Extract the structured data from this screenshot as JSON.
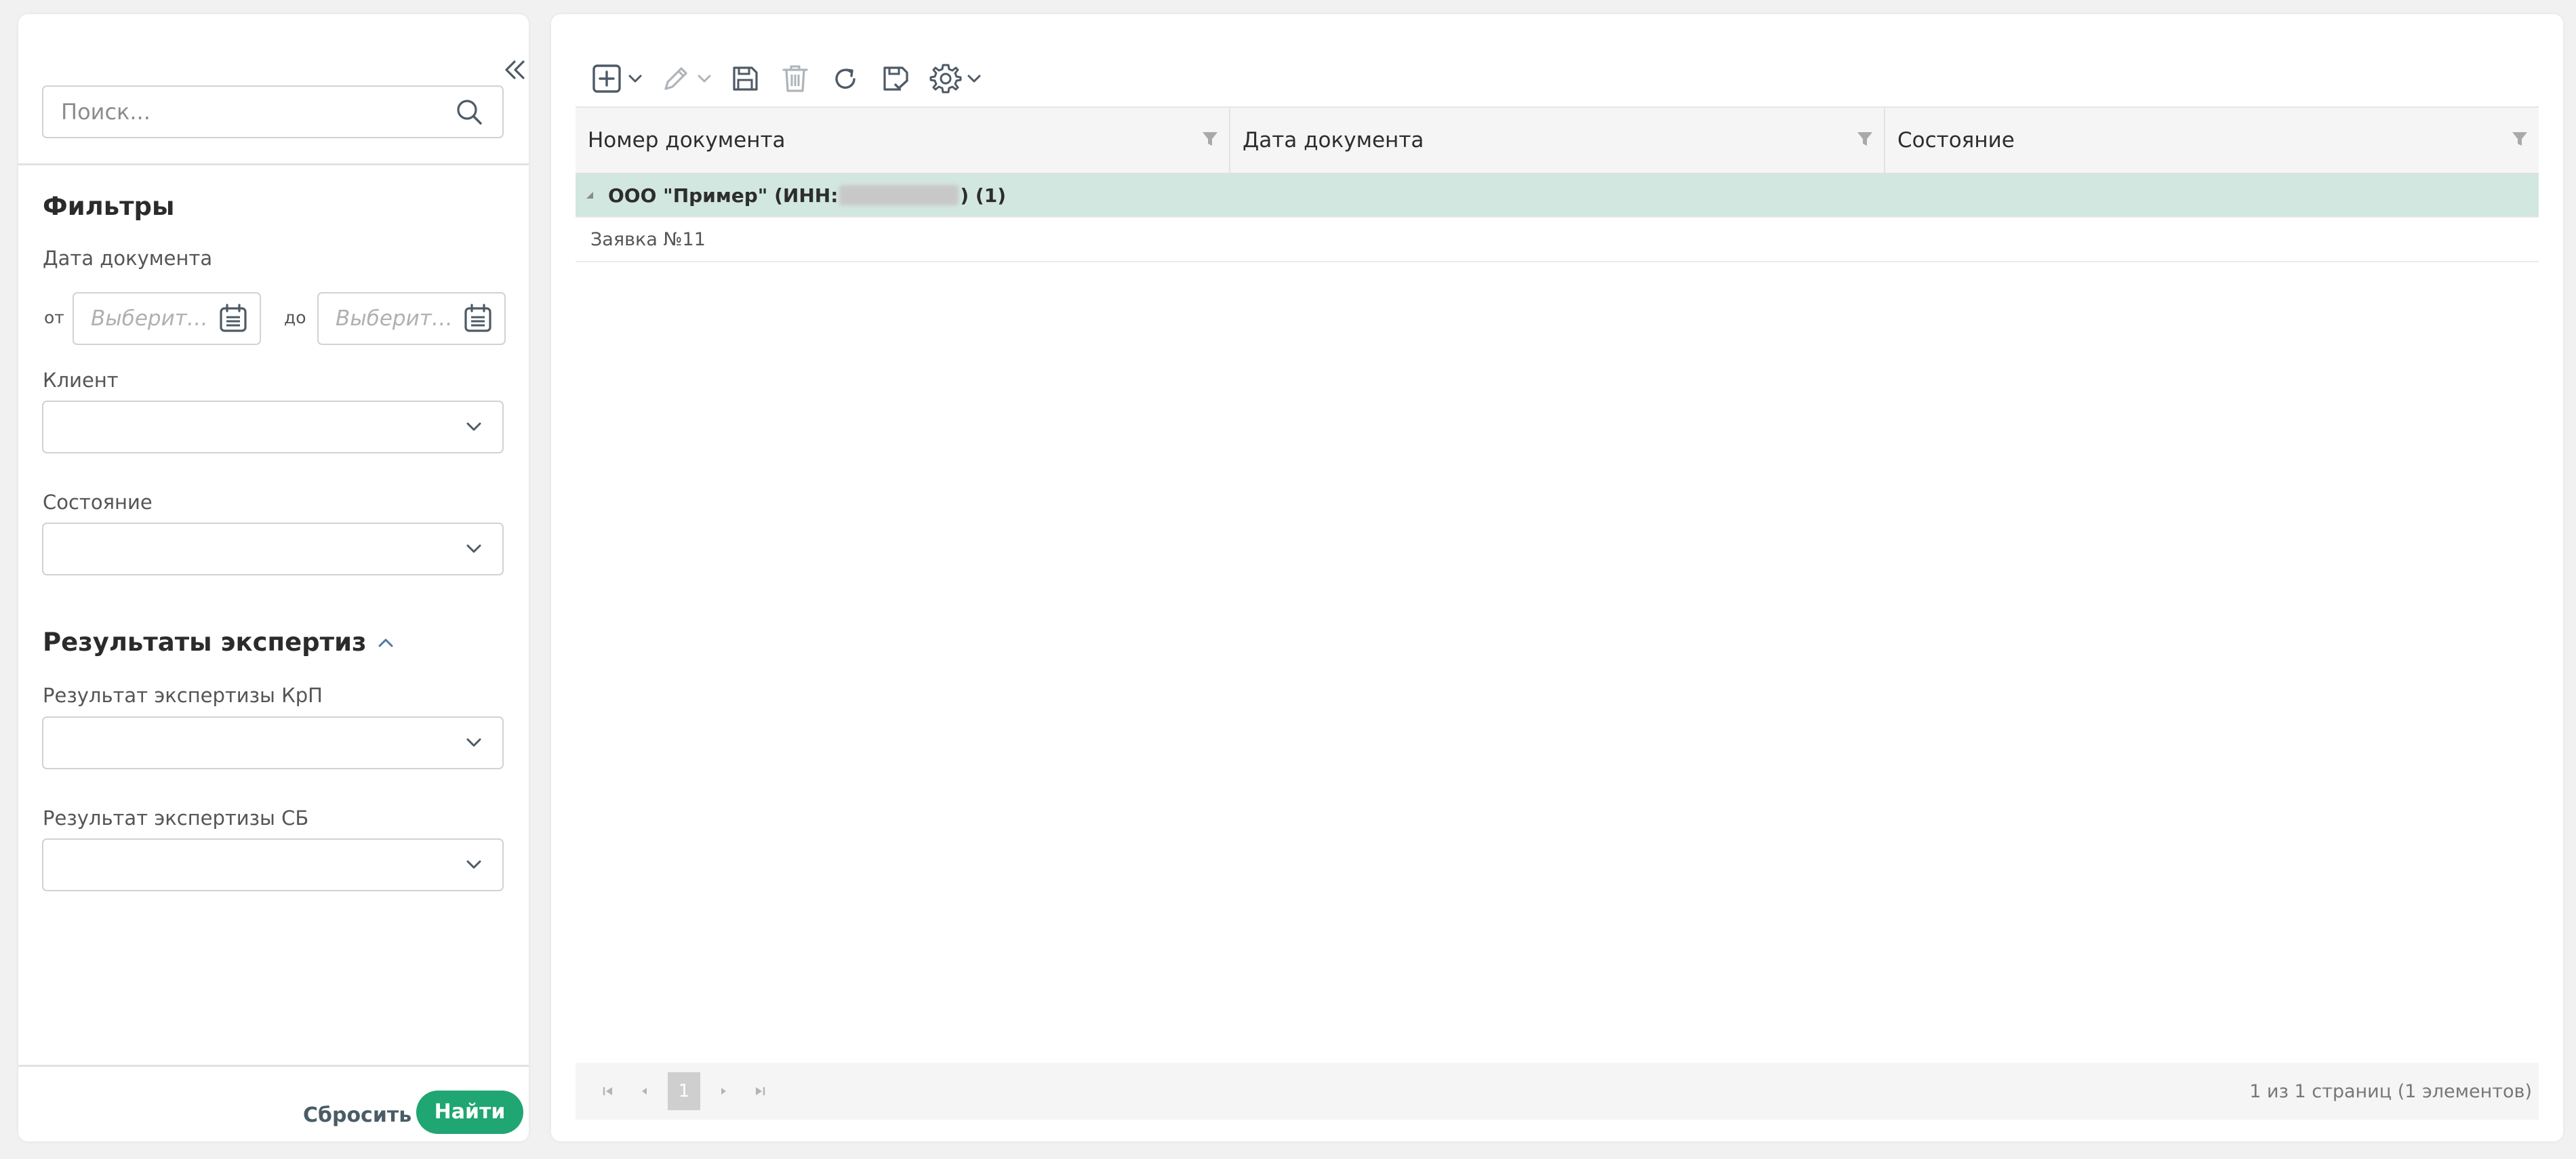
{
  "filters": {
    "search_placeholder": "Поиск...",
    "title": "Фильтры",
    "date_label": "Дата документа",
    "from_label": "от",
    "to_label": "до",
    "date_from_placeholder": "Выберите дату",
    "date_to_placeholder": "Выберите дату",
    "client_label": "Клиент",
    "state_label": "Состояние",
    "client_value": "",
    "state_value": ""
  },
  "expertise": {
    "title": "Результаты экспертиз",
    "krp_label": "Результат экспертизы КрП",
    "sb_label": "Результат экспертизы СБ",
    "krp_value": "",
    "sb_value": ""
  },
  "actions": {
    "reset_label": "Сбросить",
    "find_label": "Найти"
  },
  "toolbar": {
    "icons": [
      "add-icon",
      "edit-icon",
      "save-icon",
      "delete-icon",
      "refresh-icon",
      "save-check-icon",
      "settings-icon"
    ]
  },
  "grid": {
    "columns": [
      "Номер документа",
      "Дата документа",
      "Состояние"
    ],
    "group": {
      "prefix": "ООО \"Пример\" (ИНН:",
      "suffix": ") (1)"
    },
    "rows": [
      {
        "number": "Заявка №11",
        "date": "",
        "state": ""
      }
    ]
  },
  "pager": {
    "current_page": "1",
    "info": "1 из 1 страниц (1 элементов)"
  },
  "colors": {
    "accent": "#1fa672",
    "group_row_bg": "#d2e7df",
    "icon": "#4e5a66"
  }
}
